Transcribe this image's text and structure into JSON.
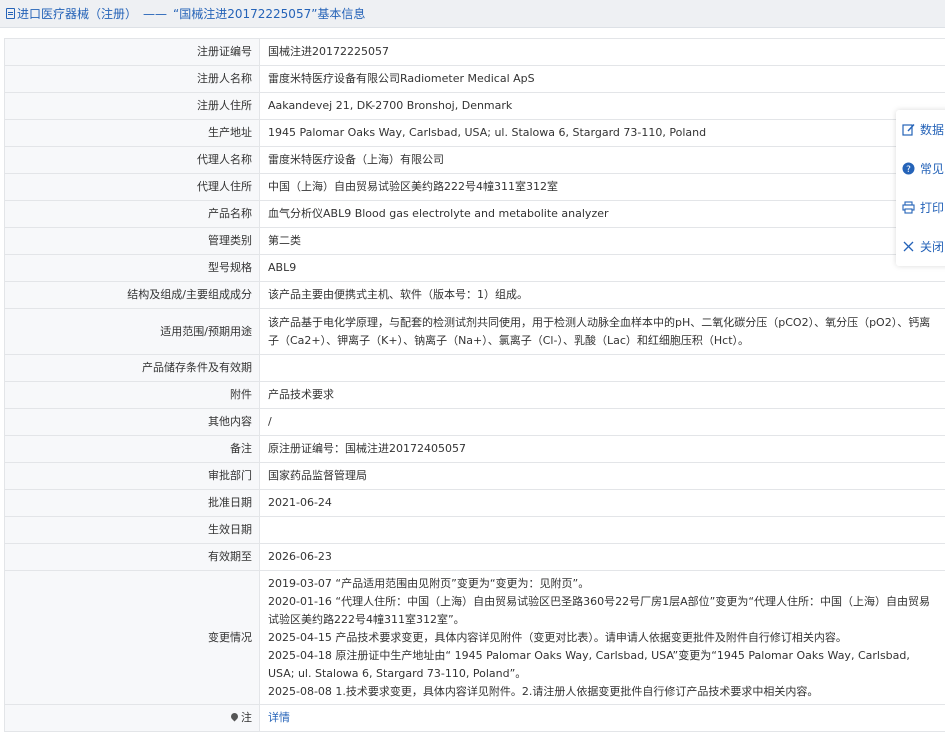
{
  "header": {
    "section": "进口医疗器械（注册）",
    "separator": "——",
    "record_title": "“国械注进20172225057”基本信息"
  },
  "rows": [
    {
      "label": "注册证编号",
      "value": "国械注进20172225057"
    },
    {
      "label": "注册人名称",
      "value": "雷度米特医疗设备有限公司Radiometer Medical ApS"
    },
    {
      "label": "注册人住所",
      "value": "Aakandevej 21, DK-2700 Bronshoj, Denmark"
    },
    {
      "label": "生产地址",
      "value": "1945 Palomar Oaks Way, Carlsbad, USA; ul. Stalowa 6, Stargard 73-110, Poland"
    },
    {
      "label": "代理人名称",
      "value": "雷度米特医疗设备（上海）有限公司"
    },
    {
      "label": "代理人住所",
      "value": "中国（上海）自由贸易试验区美约路222号4幢311室312室"
    },
    {
      "label": "产品名称",
      "value": "血气分析仪ABL9 Blood gas electrolyte and metabolite analyzer"
    },
    {
      "label": "管理类别",
      "value": "第二类"
    },
    {
      "label": "型号规格",
      "value": "ABL9"
    },
    {
      "label": "结构及组成/主要组成成分",
      "value": "该产品主要由便携式主机、软件（版本号：1）组成。"
    },
    {
      "label": "适用范围/预期用途",
      "value": "该产品基于电化学原理，与配套的检测试剂共同使用，用于检测人动脉全血样本中的pH、二氧化碳分压（pCO2）、氧分压（pO2）、钙离子（Ca2+）、钾离子（K+）、钠离子（Na+）、氯离子（Cl-）、乳酸（Lac）和红细胞压积（Hct）。"
    },
    {
      "label": "产品储存条件及有效期",
      "value": ""
    },
    {
      "label": "附件",
      "value": "产品技术要求"
    },
    {
      "label": "其他内容",
      "value": "/"
    },
    {
      "label": "备注",
      "value": "原注册证编号：国械注进20172405057"
    },
    {
      "label": "审批部门",
      "value": "国家药品监督管理局"
    },
    {
      "label": "批准日期",
      "value": "2021-06-24"
    },
    {
      "label": "生效日期",
      "value": ""
    },
    {
      "label": "有效期至",
      "value": "2026-06-23"
    }
  ],
  "changes": {
    "label": "变更情况",
    "entries": [
      "2019-03-07 “产品适用范围由见附页”变更为“变更为：见附页”。",
      "2020-01-16 “代理人住所：中国（上海）自由贸易试验区巴圣路360号22号厂房1层A部位”变更为“代理人住所：中国（上海）自由贸易试验区美约路222号4幢311室312室”。",
      "2025-04-15 产品技术要求变更，具体内容详见附件（变更对比表）。请申请人依据变更批件及附件自行修订相关内容。",
      "2025-04-18 原注册证中生产地址由“ 1945 Palomar Oaks Way, Carlsbad, USA”变更为“1945 Palomar Oaks Way, Carlsbad, USA; ul. Stalowa 6, Stargard 73-110, Poland”。",
      "2025-08-08 1.技术要求变更，具体内容详见附件。2.请注册人依据变更批件自行修订产品技术要求中相关内容。"
    ]
  },
  "note": {
    "label": "注",
    "link_text": "详情"
  },
  "side_panel": [
    {
      "icon": "edit-icon",
      "label": "数据"
    },
    {
      "icon": "question-icon",
      "label": "常见"
    },
    {
      "icon": "printer-icon",
      "label": "打印"
    },
    {
      "icon": "close-icon",
      "label": "关闭"
    }
  ],
  "colors": {
    "accent": "#2563b8",
    "label_bg": "#f7f8fa",
    "border": "#e3e5e8",
    "title_bg": "#eef0f3"
  }
}
